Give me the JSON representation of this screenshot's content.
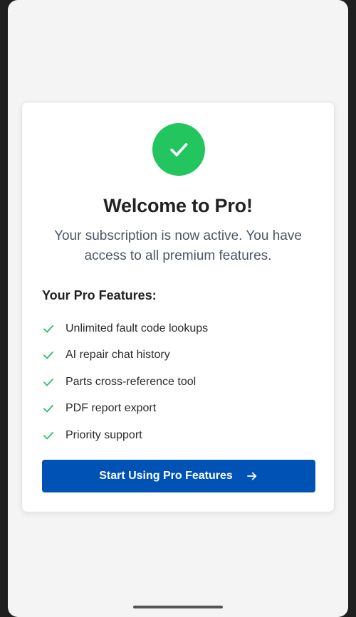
{
  "card": {
    "title": "Welcome to Pro!",
    "subtitle": "Your subscription is now active. You have access to all premium features.",
    "features_heading": "Your Pro Features:",
    "features": [
      {
        "label": "Unlimited fault code lookups"
      },
      {
        "label": "AI repair chat history"
      },
      {
        "label": "Parts cross-reference tool"
      },
      {
        "label": "PDF report export"
      },
      {
        "label": "Priority support"
      }
    ],
    "cta_label": "Start Using Pro Features"
  },
  "icons": {
    "success": "check-circle-icon",
    "feature": "check-icon",
    "cta": "arrow-right-icon"
  },
  "colors": {
    "success_green": "#22c55e",
    "primary_blue": "#0052b4",
    "background": "#f4f4f4",
    "card": "#ffffff"
  }
}
